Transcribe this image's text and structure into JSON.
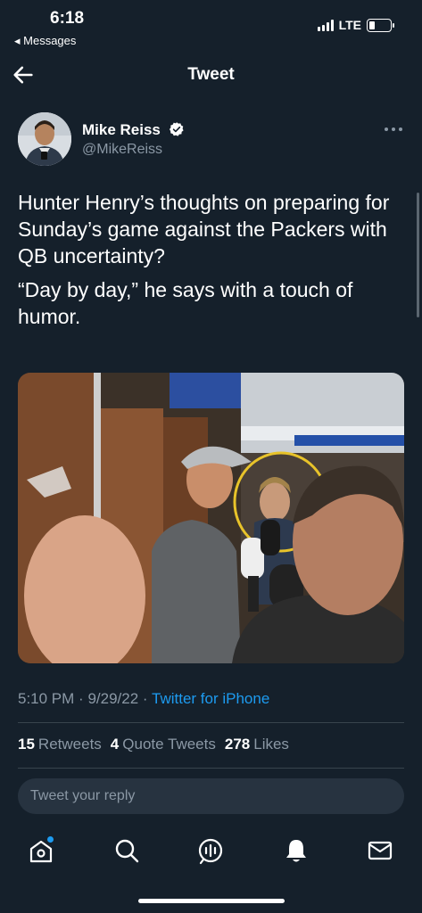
{
  "status": {
    "time": "6:18",
    "back_label": "◂ Messages",
    "network": "LTE"
  },
  "header": {
    "title": "Tweet"
  },
  "tweet": {
    "author_name": "Mike Reiss",
    "author_handle": "@MikeReiss",
    "paragraphs": [
      "Hunter Henry’s thoughts on preparing for Sunday’s game against the Packers with QB uncertainty?",
      "“Day by day,” he says with a touch of humor."
    ],
    "time": "5:10 PM",
    "date": "9/29/22",
    "source": "Twitter for iPhone",
    "retweets_count": "15",
    "retweets_label": "Retweets",
    "quotes_count": "4",
    "quotes_label": "Quote Tweets",
    "likes_count": "278",
    "likes_label": "Likes"
  },
  "reply": {
    "placeholder": "Tweet your reply"
  },
  "tabs": [
    {
      "icon": "home-icon"
    },
    {
      "icon": "search-icon"
    },
    {
      "icon": "spaces-icon"
    },
    {
      "icon": "notifications-icon"
    },
    {
      "icon": "messages-icon"
    }
  ],
  "colors": {
    "background": "#15202b",
    "accent": "#1d9bf0",
    "secondary_text": "#8b98a5"
  }
}
